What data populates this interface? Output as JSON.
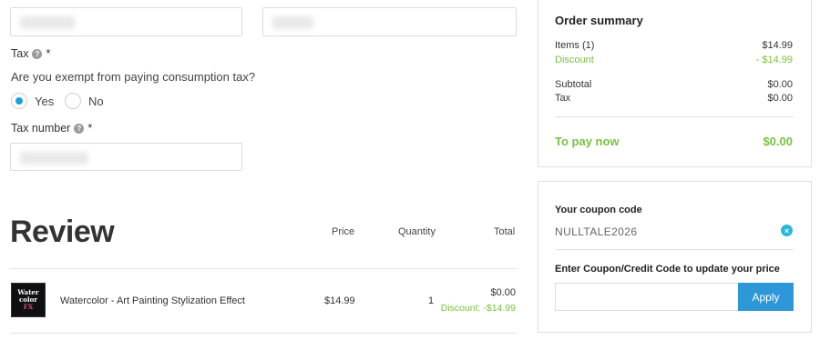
{
  "form": {
    "tax_label": "Tax",
    "required_mark": "*",
    "exempt_question": "Are you exempt from paying consumption tax?",
    "option_yes": "Yes",
    "option_no": "No",
    "selected_option": "Yes",
    "tax_number_label": "Tax number",
    "help_glyph": "?"
  },
  "review": {
    "title": "Review",
    "columns": {
      "price": "Price",
      "quantity": "Quantity",
      "total": "Total"
    },
    "items": [
      {
        "name": "Watercolor - Art Painting Stylization Effect",
        "thumb_lines": [
          "Water",
          "color",
          "FX"
        ],
        "price": "$14.99",
        "quantity": "1",
        "total": "$0.00",
        "discount": "Discount: -$14.99"
      }
    ]
  },
  "summary": {
    "title": "Order summary",
    "items_label": "Items (1)",
    "items_value": "$14.99",
    "discount_label": "Discount",
    "discount_value": "- $14.99",
    "subtotal_label": "Subtotal",
    "subtotal_value": "$0.00",
    "tax_label": "Tax",
    "tax_value": "$0.00",
    "pay_label": "To pay now",
    "pay_value": "$0.00"
  },
  "coupon": {
    "your_code_label": "Your coupon code",
    "code": "NULLTALE2026",
    "enter_label": "Enter Coupon/Credit Code to update your price",
    "input_value": "",
    "apply_label": "Apply",
    "remove_glyph": "×"
  },
  "colors": {
    "accent_blue": "#2d97d8",
    "radio_blue": "#1aa3d8",
    "discount_green": "#7ac142"
  }
}
